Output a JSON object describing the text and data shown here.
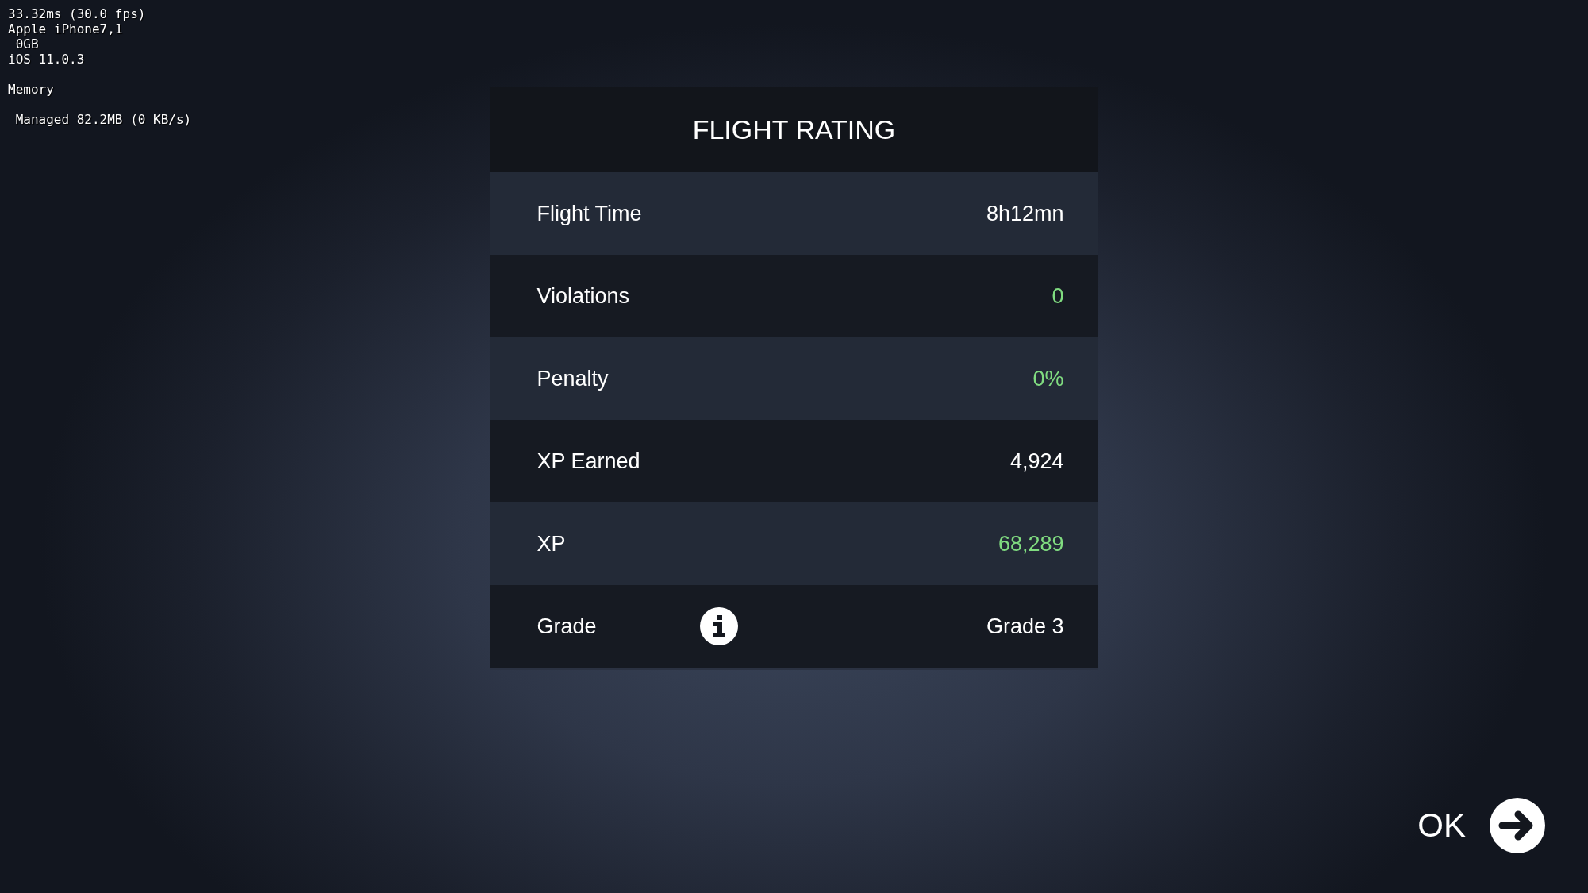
{
  "debug_overlay": {
    "groups": [
      {
        "lines": [
          "33.32ms (30.0 fps)",
          "Apple iPhone7,1",
          " 0GB",
          "iOS 11.0.3"
        ]
      },
      {
        "lines": [
          "Memory"
        ]
      },
      {
        "lines": [
          " Managed 82.2MB (0 KB/s)"
        ]
      }
    ]
  },
  "panel": {
    "title": "FLIGHT RATING",
    "rows": [
      {
        "label": "Flight Time",
        "value": "8h12mn",
        "color": "#ffffff",
        "has_info": false
      },
      {
        "label": "Violations",
        "value": "0",
        "color": "#80dc80",
        "has_info": false
      },
      {
        "label": "Penalty",
        "value": "0%",
        "color": "#80dc80",
        "has_info": false
      },
      {
        "label": "XP Earned",
        "value": "4,924",
        "color": "#ffffff",
        "has_info": false
      },
      {
        "label": "XP",
        "value": "68,289",
        "color": "#80dc80",
        "has_info": false
      },
      {
        "label": "Grade",
        "value": "Grade 3",
        "color": "#ffffff",
        "has_info": true
      }
    ]
  },
  "ok_button": {
    "label": "OK"
  }
}
